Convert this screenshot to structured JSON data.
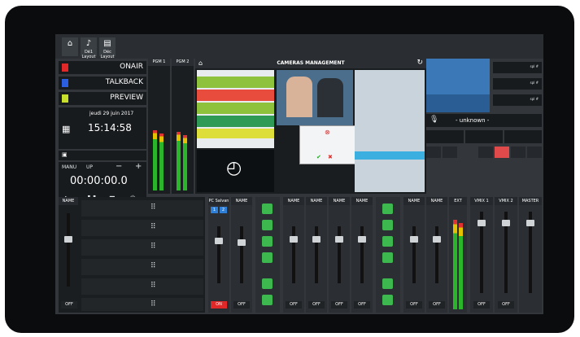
{
  "topbar": {
    "btn1_label": "",
    "btn2_label": "Dé1 Layout",
    "btn3_label": "Déc Layout"
  },
  "modes": [
    {
      "label": "ONAIR",
      "color": "#e02828"
    },
    {
      "label": "TALKBACK",
      "color": "#2b5ee0"
    },
    {
      "label": "PREVIEW",
      "color": "#c8e02b"
    }
  ],
  "date": "jeudi 29 juin 2017",
  "time": "15:14:58",
  "timer": {
    "manu": "MANU",
    "up": "UP",
    "minus": "−",
    "plus": "+",
    "value": "00:00:00.0"
  },
  "vu": {
    "pgm1": "PGM 1",
    "pgm2": "PGM 2"
  },
  "cameras": {
    "title": "CAMERAS MANAGEMENT"
  },
  "right": {
    "unknown": "- unknown -",
    "ctrl": "spl #"
  },
  "mixer": {
    "name": "NAME",
    "pc_salvan": "PC Salvan",
    "ext": "EXT",
    "vmix1": "VMIX 1",
    "vmix2": "VMIX 2",
    "master": "MASTER",
    "off": "OFF",
    "on": "ON"
  }
}
